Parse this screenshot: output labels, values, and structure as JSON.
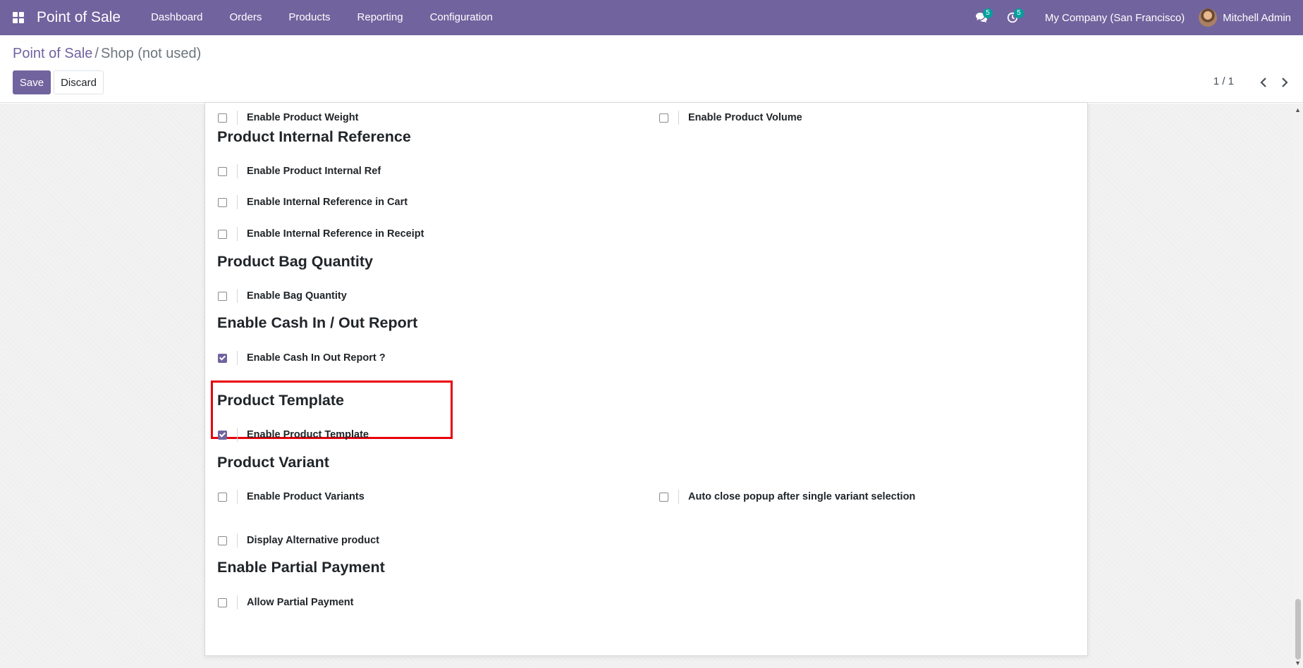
{
  "navbar": {
    "app_title": "Point of Sale",
    "menu": [
      "Dashboard",
      "Orders",
      "Products",
      "Reporting",
      "Configuration"
    ],
    "messages_count": "5",
    "activities_count": "5",
    "company": "My Company (San Francisco)",
    "user": "Mitchell Admin",
    "color": "#71639e"
  },
  "breadcrumb": {
    "parent": "Point of Sale",
    "separator": "/",
    "current": "Shop (not used)"
  },
  "buttons": {
    "save": "Save",
    "discard": "Discard"
  },
  "pager": {
    "value": "1 / 1"
  },
  "settings": {
    "weight": {
      "label": "Enable Product Weight",
      "checked": false
    },
    "volume": {
      "label": "Enable Product Volume",
      "checked": false
    },
    "internal_ref": {
      "heading": "Product Internal Reference",
      "enable": {
        "label": "Enable Product Internal Ref",
        "checked": false
      },
      "cart": {
        "label": "Enable Internal Reference in Cart",
        "checked": false
      },
      "receipt": {
        "label": "Enable Internal Reference in Receipt",
        "checked": false
      }
    },
    "bag": {
      "heading": "Product Bag Quantity",
      "enable": {
        "label": "Enable Bag Quantity",
        "checked": false
      }
    },
    "cash": {
      "heading": "Enable Cash In / Out Report",
      "enable": {
        "label": "Enable Cash In Out Report ?",
        "checked": true
      }
    },
    "template": {
      "heading": "Product Template",
      "enable": {
        "label": "Enable Product Template",
        "checked": true
      }
    },
    "variant": {
      "heading": "Product Variant",
      "enable": {
        "label": "Enable Product Variants",
        "checked": false
      },
      "auto_close": {
        "label": "Auto close popup after single variant selection",
        "checked": false
      },
      "alternative": {
        "label": "Display Alternative product",
        "checked": false
      }
    },
    "partial": {
      "heading": "Enable Partial Payment",
      "allow": {
        "label": "Allow Partial Payment",
        "checked": false
      }
    }
  },
  "colors": {
    "accent": "#71639e",
    "highlight": "#e8000b"
  }
}
